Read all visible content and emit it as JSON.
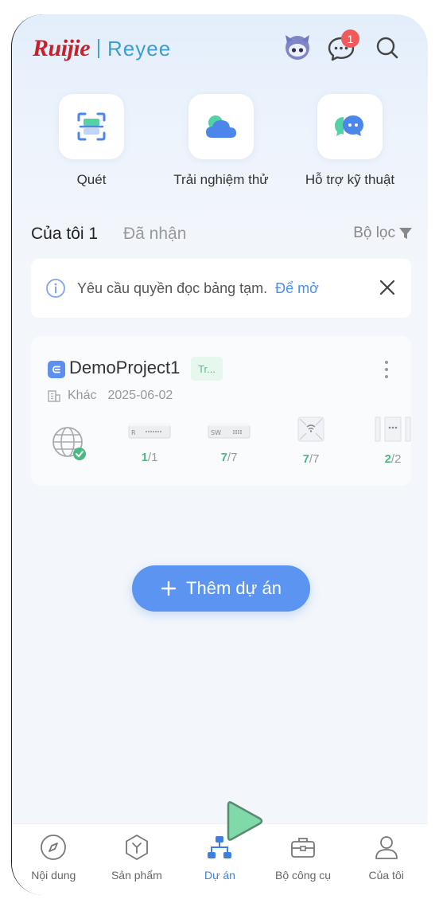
{
  "header": {
    "brand_ruijie": "Ruijie",
    "brand_reyee": "Reyee",
    "message_badge": "1"
  },
  "quick_actions": [
    {
      "label": "Quét",
      "icon": "scan-icon"
    },
    {
      "label": "Trải nghiệm thử",
      "icon": "cloud-icon"
    },
    {
      "label": "Hỗ trợ kỹ thuật",
      "icon": "support-chat-icon"
    }
  ],
  "tabs": {
    "mine": "Của tôi 1",
    "received": "Đã nhận",
    "filter": "Bộ lọc"
  },
  "notice": {
    "text": "Yêu cầu quyền đọc bảng tạm.",
    "link": "Để mở"
  },
  "project": {
    "name": "DemoProject1",
    "tag": "Tr...",
    "category": "Khác",
    "date": "2025-06-02",
    "devices": [
      {
        "type": "router",
        "label": "R",
        "online": "1",
        "total": "/1"
      },
      {
        "type": "switch",
        "label": "SW",
        "online": "7",
        "total": "/7"
      },
      {
        "type": "access-point",
        "label": "",
        "online": "7",
        "total": "/7"
      },
      {
        "type": "bridge",
        "label": "",
        "online": "2",
        "total": "/2"
      }
    ]
  },
  "add_project": "Thêm dự án",
  "bottom_nav": [
    {
      "label": "Nội dung",
      "icon": "compass-icon",
      "active": false
    },
    {
      "label": "Sản phẩm",
      "icon": "product-icon",
      "active": false
    },
    {
      "label": "Dự án",
      "icon": "project-network-icon",
      "active": true
    },
    {
      "label": "Bộ công cụ",
      "icon": "toolbox-icon",
      "active": false
    },
    {
      "label": "Của tôi",
      "icon": "user-icon",
      "active": false
    }
  ],
  "colors": {
    "accent": "#5b95f1",
    "brand_red": "#c8202a",
    "brand_blue": "#3a9fd0",
    "success": "#4cb884",
    "badge": "#f05a5a"
  }
}
